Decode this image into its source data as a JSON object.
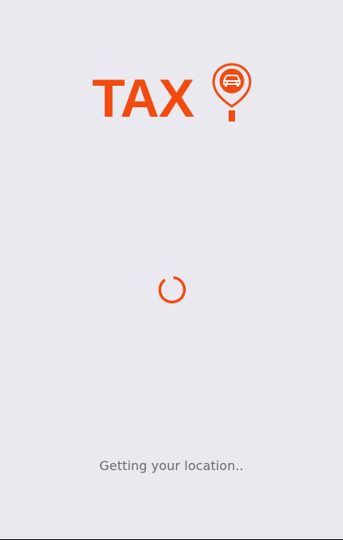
{
  "logo": {
    "text": "TAX",
    "pin_icon": "taxi-location-pin-icon",
    "brand_color": "#f24a0f"
  },
  "loader": {
    "icon": "loading-spinner-icon",
    "color": "#f24a0f"
  },
  "status": {
    "message": "Getting your location.."
  },
  "colors": {
    "background": "#ebe9f0",
    "status_text": "#666870"
  }
}
